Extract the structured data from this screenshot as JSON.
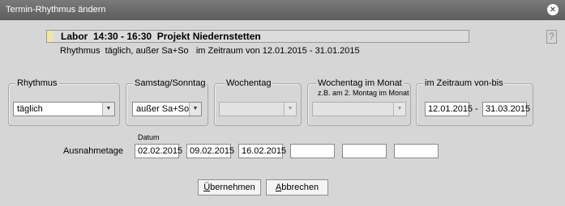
{
  "window": {
    "title": "Termin-Rhythmus ändern",
    "close_icon": "×",
    "help_icon": "?"
  },
  "info": {
    "headline": "Labor  14:30 - 16:30  Projekt Niedernstetten",
    "subline": "Rhythmus  täglich, außer Sa+So   im Zeitraum von 12.01.2015 - 31.01.2015"
  },
  "groups": {
    "rhythmus": {
      "legend": "Rhythmus",
      "value": "täglich"
    },
    "samstag": {
      "legend": "Samstag/Sonntag",
      "value": "außer Sa+So"
    },
    "wochentag": {
      "legend": "Wochentag",
      "value": ""
    },
    "wochentag_monat": {
      "legend": "Wochentag im Monat",
      "hint": "z.B. am 2. Montag im Monat",
      "value": ""
    },
    "zeitraum": {
      "legend": "im Zeitraum von-bis",
      "from": "12.01.2015",
      "separator": "-",
      "to": "31.03.2015"
    }
  },
  "ausnahmetage": {
    "label": "Ausnahmetage",
    "datum_label": "Datum",
    "dates": [
      "02.02.2015",
      "09.02.2015",
      "16.02.2015",
      "",
      "",
      ""
    ]
  },
  "buttons": {
    "apply_first": "Ü",
    "apply_rest": "bernehmen",
    "cancel_first": "A",
    "cancel_rest": "bbrechen"
  }
}
